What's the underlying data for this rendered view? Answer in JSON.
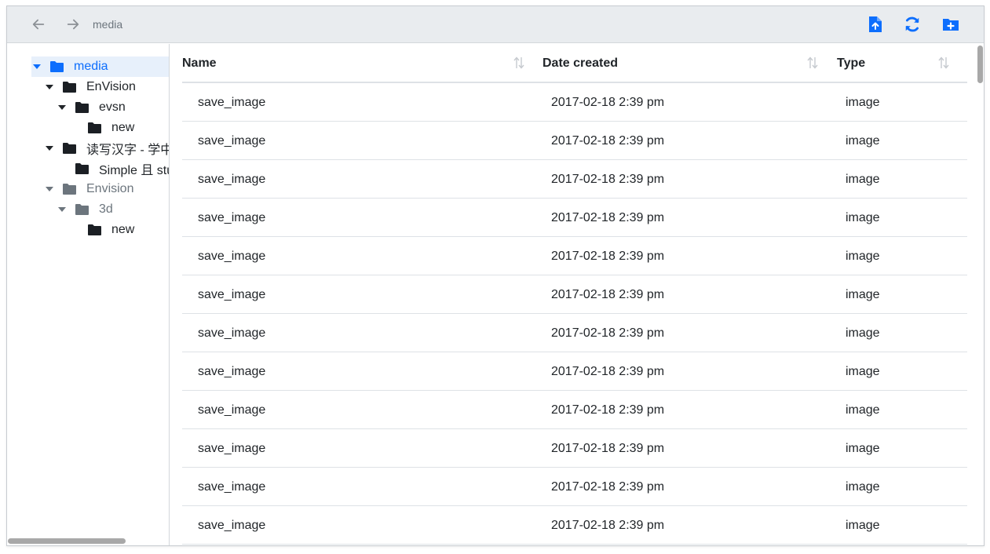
{
  "toolbar": {
    "back_icon": "arrow-left-icon",
    "forward_icon": "arrow-right-icon",
    "breadcrumb": "media",
    "upload_icon": "file-upload-icon",
    "refresh_icon": "refresh-icon",
    "new_folder_icon": "folder-plus-icon",
    "accent_color": "#0d6efd"
  },
  "tree": [
    {
      "label": "media",
      "caret": "down",
      "selected": true,
      "muted": false
    },
    {
      "label": "EnVision",
      "caret": "down",
      "selected": false,
      "muted": false
    },
    {
      "label": "evsn",
      "caret": "down",
      "selected": false,
      "muted": false
    },
    {
      "label": "new",
      "caret": "none",
      "selected": false,
      "muted": false
    },
    {
      "label": "读写汉字 - 学中文",
      "caret": "down",
      "selected": false,
      "muted": false
    },
    {
      "label": "Simple 且 stuff",
      "caret": "none",
      "selected": false,
      "muted": false
    },
    {
      "label": "Envision",
      "caret": "down",
      "selected": false,
      "muted": true
    },
    {
      "label": "3d",
      "caret": "down",
      "selected": false,
      "muted": true
    },
    {
      "label": "new",
      "caret": "none",
      "selected": false,
      "muted": false
    }
  ],
  "table": {
    "columns": [
      "Name",
      "Date created",
      "Type"
    ],
    "rows": [
      {
        "name": "save_image",
        "date": "2017-02-18 2:39 pm",
        "type": "image"
      },
      {
        "name": "save_image",
        "date": "2017-02-18 2:39 pm",
        "type": "image"
      },
      {
        "name": "save_image",
        "date": "2017-02-18 2:39 pm",
        "type": "image"
      },
      {
        "name": "save_image",
        "date": "2017-02-18 2:39 pm",
        "type": "image"
      },
      {
        "name": "save_image",
        "date": "2017-02-18 2:39 pm",
        "type": "image"
      },
      {
        "name": "save_image",
        "date": "2017-02-18 2:39 pm",
        "type": "image"
      },
      {
        "name": "save_image",
        "date": "2017-02-18 2:39 pm",
        "type": "image"
      },
      {
        "name": "save_image",
        "date": "2017-02-18 2:39 pm",
        "type": "image"
      },
      {
        "name": "save_image",
        "date": "2017-02-18 2:39 pm",
        "type": "image"
      },
      {
        "name": "save_image",
        "date": "2017-02-18 2:39 pm",
        "type": "image"
      },
      {
        "name": "save_image",
        "date": "2017-02-18 2:39 pm",
        "type": "image"
      },
      {
        "name": "save_image",
        "date": "2017-02-18 2:39 pm",
        "type": "image"
      }
    ]
  }
}
